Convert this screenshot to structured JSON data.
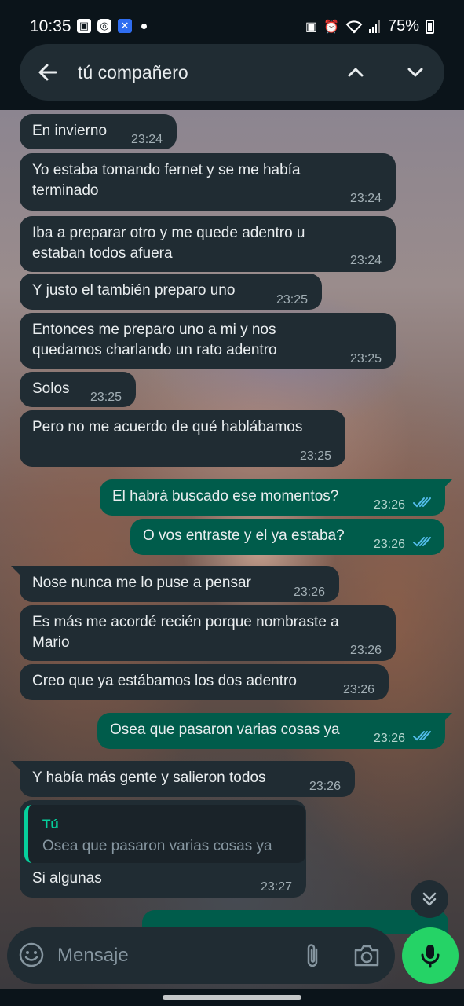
{
  "status_bar": {
    "time": "10:35",
    "battery": "75%"
  },
  "search": {
    "query": "tú compañero"
  },
  "messages": [
    {
      "dir": "in",
      "lines": [
        "En invierno"
      ],
      "time": "23:24"
    },
    {
      "dir": "in",
      "lines": [
        "Yo estaba tomando fernet y se me había",
        "terminado"
      ],
      "time": "23:24"
    },
    {
      "dir": "in",
      "lines": [
        "Iba a preparar otro y me quede adentro u",
        "estaban todos afuera"
      ],
      "time": "23:24"
    },
    {
      "dir": "in",
      "lines": [
        "Y justo el también preparo uno"
      ],
      "time": "23:25"
    },
    {
      "dir": "in",
      "lines": [
        "Entonces me preparo uno a mi y nos",
        "quedamos charlando un rato adentro"
      ],
      "time": "23:25"
    },
    {
      "dir": "in",
      "lines": [
        "Solos"
      ],
      "time": "23:25"
    },
    {
      "dir": "in",
      "lines": [
        "Pero no me acuerdo de qué hablábamos"
      ],
      "time": "23:25"
    },
    {
      "dir": "out",
      "lines": [
        "El habrá buscado ese momentos?"
      ],
      "time": "23:26"
    },
    {
      "dir": "out",
      "lines": [
        "O vos entraste y el ya estaba?"
      ],
      "time": "23:26"
    },
    {
      "dir": "in",
      "lines": [
        "Nose nunca me lo puse a pensar"
      ],
      "time": "23:26"
    },
    {
      "dir": "in",
      "lines": [
        "Es más me acordé recién porque nombraste a",
        "Mario"
      ],
      "time": "23:26"
    },
    {
      "dir": "in",
      "lines": [
        "Creo que ya estábamos los dos adentro"
      ],
      "time": "23:26"
    },
    {
      "dir": "out",
      "lines": [
        "Osea que pasaron varias cosas ya"
      ],
      "time": "23:26"
    },
    {
      "dir": "in",
      "lines": [
        "Y había más gente y salieron todos"
      ],
      "time": "23:26"
    },
    {
      "dir": "in",
      "quote_author": "Tú",
      "quote_text": "Osea que pasaron varias cosas ya",
      "lines": [
        "Si algunas"
      ],
      "time": "23:27"
    }
  ],
  "input": {
    "placeholder": "Mensaje"
  },
  "icons": {
    "back": "arrow-left-icon",
    "up": "chevron-up-icon",
    "down": "chevron-down-icon",
    "emoji": "emoji-icon",
    "attach": "paperclip-icon",
    "camera": "camera-icon",
    "mic": "microphone-icon",
    "scroll": "double-chevron-down-icon"
  },
  "colors": {
    "incoming_bubble": "#202c33",
    "outgoing_bubble": "#005c4b",
    "accent": "#25d366",
    "read_tick": "#53bdeb"
  }
}
